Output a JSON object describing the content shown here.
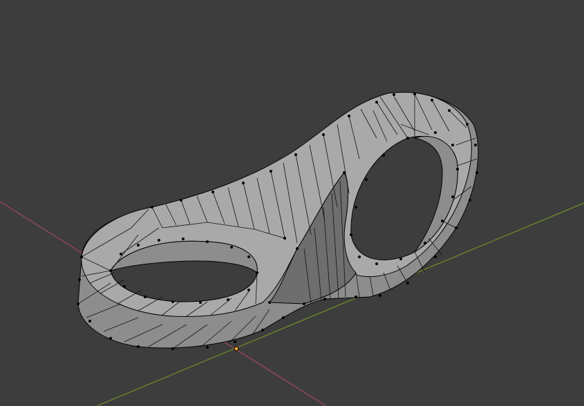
{
  "app": "3D viewport",
  "viewport": {
    "background": "#3d3d3d",
    "axes": [
      {
        "name": "x-axis",
        "color": "#9b4a59"
      },
      {
        "name": "y-axis",
        "color": "#6b8a2b"
      }
    ],
    "origin_color": "#f0a030",
    "object": {
      "name": "mesh-object",
      "mode": "edit",
      "display": "wireframe-overlay",
      "color": "#9c9c9c"
    }
  }
}
